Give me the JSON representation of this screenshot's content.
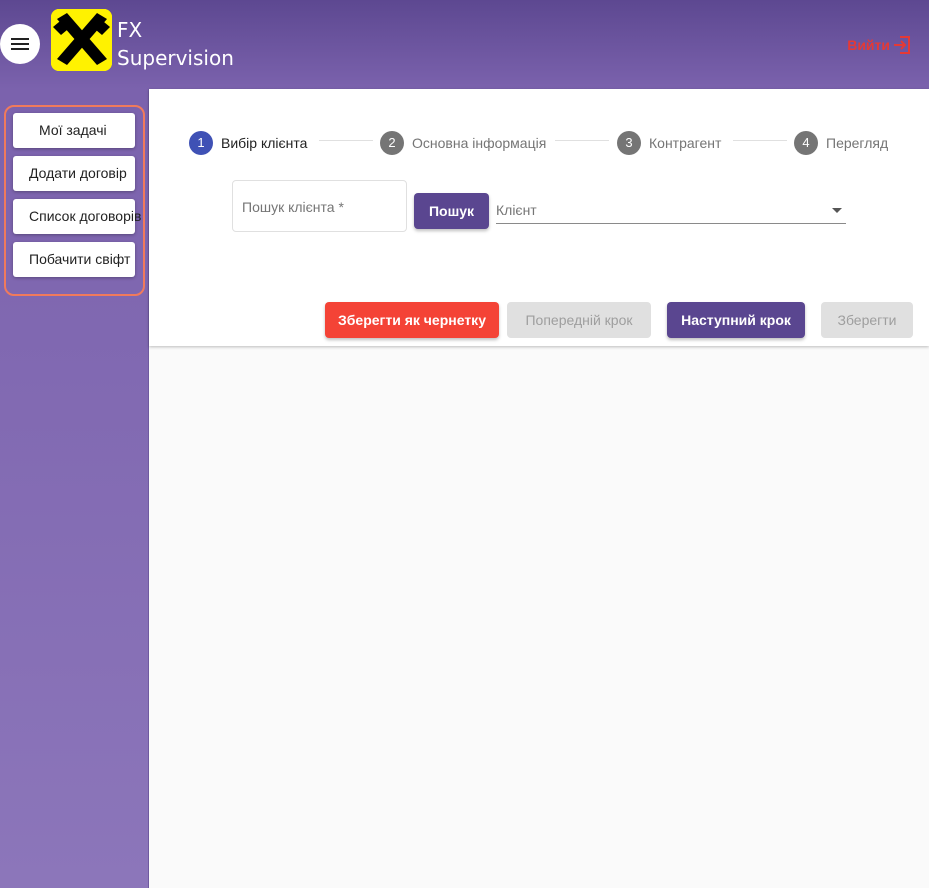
{
  "header": {
    "title_line1": "FX",
    "title_line2": "Supervision",
    "logout_label": "Вийти",
    "colors": {
      "header_top": "#5d4891",
      "header_bottom": "#7b62ad",
      "logout": "#e53935",
      "logo_bg": "#fff200"
    }
  },
  "sidebar": {
    "items": [
      {
        "label": "Мої задачі"
      },
      {
        "label": "Додати договір"
      },
      {
        "label": "Список договорів"
      },
      {
        "label": "Побачити свіфт"
      }
    ]
  },
  "stepper": {
    "steps": [
      {
        "num": "1",
        "label": "Вибір клієнта",
        "state": "active"
      },
      {
        "num": "2",
        "label": "Основна інформація",
        "state": "inactive"
      },
      {
        "num": "3",
        "label": "Контрагент",
        "state": "inactive"
      },
      {
        "num": "4",
        "label": "Перегляд",
        "state": "inactive"
      }
    ]
  },
  "form": {
    "search_placeholder": "Пошук клієнта *",
    "search_button": "Пошук",
    "client_select_placeholder": "Клієнт"
  },
  "actions": {
    "save_draft": "Зберегти як чернетку",
    "prev_step": "Попередній крок",
    "next_step": "Наступний крок",
    "save": "Зберегти"
  }
}
